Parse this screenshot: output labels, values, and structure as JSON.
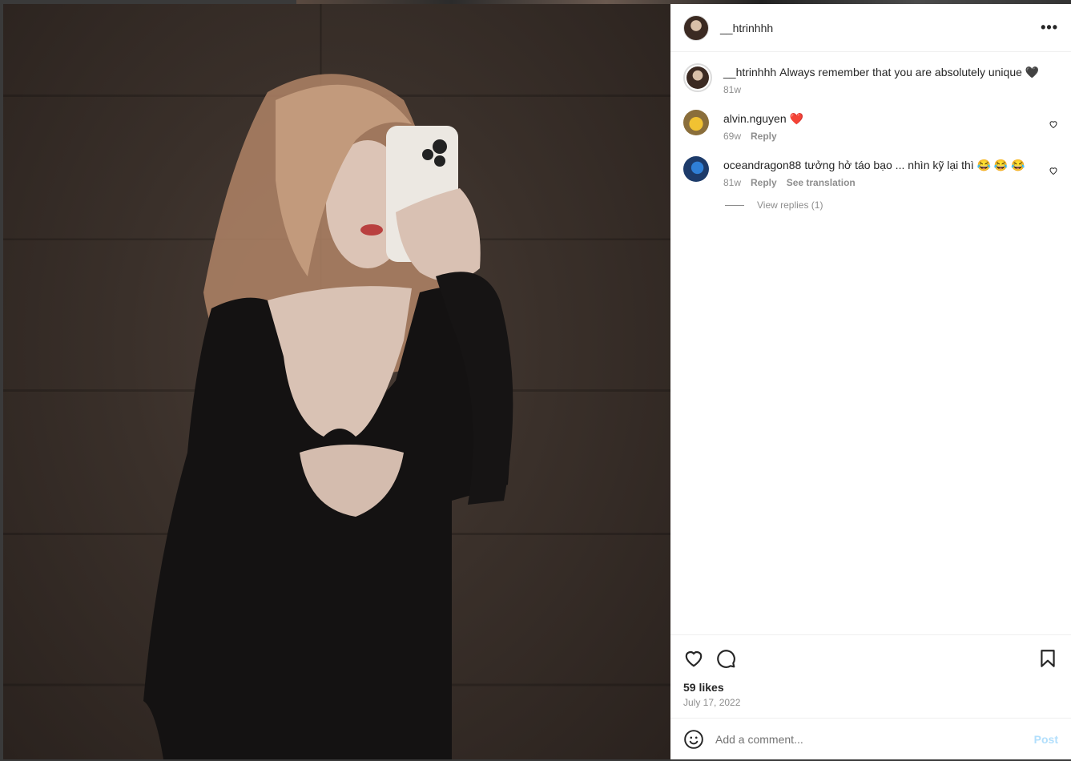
{
  "post": {
    "author": "__htrinhhh",
    "more_icon": "more-horizontal-icon"
  },
  "caption": {
    "username": "__htrinhhh",
    "text": "Always remember that you are absolutely unique 🖤",
    "age": "81w"
  },
  "comments": [
    {
      "username": "alvin.nguyen",
      "text": "❤️",
      "age": "69w",
      "reply_label": "Reply"
    },
    {
      "username": "oceandragon88",
      "text": "tưởng hở táo bạo ... nhìn kỹ lại thì 😂 😂 😂",
      "age": "81w",
      "reply_label": "Reply",
      "translate_label": "See translation"
    }
  ],
  "view_replies": "View replies (1)",
  "likes": "59 likes",
  "date": "July 17, 2022",
  "add_comment": {
    "placeholder": "Add a comment...",
    "post_label": "Post"
  },
  "colors": {
    "text": "#262626",
    "muted": "#8e8e8e",
    "post_disabled": "#b2dffc",
    "border": "#efefef"
  }
}
